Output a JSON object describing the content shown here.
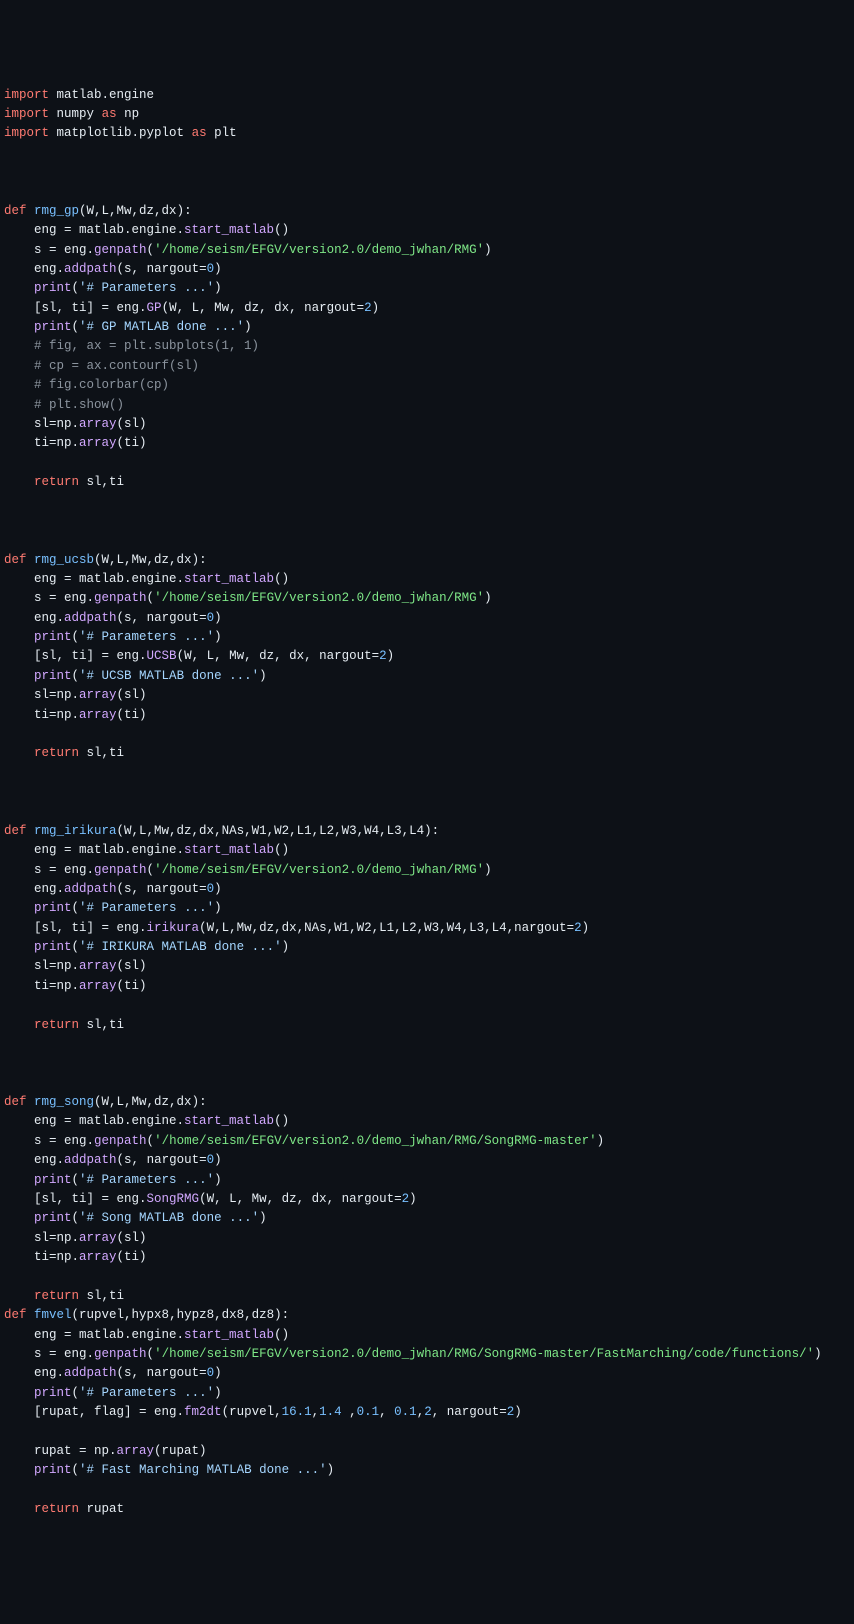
{
  "code": {
    "import1": {
      "kw": "import",
      "mod": "matlab.engine"
    },
    "import2": {
      "kw": "import",
      "mod": "numpy",
      "as": "as",
      "alias": "np"
    },
    "import3": {
      "kw": "import",
      "mod": "matplotlib.pyplot",
      "as": "as",
      "alias": "plt"
    },
    "fn_rmg_gp": {
      "def": "def",
      "name": "rmg_gp",
      "params": "(W,L,Mw,dz,dx):",
      "l1a": "eng = matlab.engine.",
      "l1b": "start_matlab",
      "l1c": "()",
      "l2a": "s = eng.",
      "l2b": "genpath",
      "l2c": "(",
      "l2str": "'/home/seism/EFGV/version2.0/demo_jwhan/RMG'",
      "l2d": ")",
      "l3a": "eng.",
      "l3b": "addpath",
      "l3c": "(s, ",
      "l3d": "nargout",
      "l3e": "=",
      "l3num": "0",
      "l3f": ")",
      "l4a": "print",
      "l4b": "(",
      "l4str": "'# Parameters ...'",
      "l4c": ")",
      "l5a": "[sl, ti] = eng.",
      "l5b": "GP",
      "l5c": "(W, L, Mw, dz, dx, ",
      "l5d": "nargout",
      "l5e": "=",
      "l5num": "2",
      "l5f": ")",
      "l6a": "print",
      "l6b": "(",
      "l6str": "'# GP MATLAB done ...'",
      "l6c": ")",
      "c1": "# fig, ax = plt.subplots(1, 1)",
      "c2": "# cp = ax.contourf(sl)",
      "c3": "# fig.colorbar(cp)",
      "c4": "# plt.show()",
      "l7": "sl=np.",
      "l7b": "array",
      "l7c": "(sl)",
      "l8": "ti=np.",
      "l8b": "array",
      "l8c": "(ti)",
      "ret": "return",
      "retv": " sl,ti"
    },
    "fn_rmg_ucsb": {
      "def": "def",
      "name": "rmg_ucsb",
      "params": "(W,L,Mw,dz,dx):",
      "l1a": "eng = matlab.engine.",
      "l1b": "start_matlab",
      "l1c": "()",
      "l2a": "s = eng.",
      "l2b": "genpath",
      "l2c": "(",
      "l2str": "'/home/seism/EFGV/version2.0/demo_jwhan/RMG'",
      "l2d": ")",
      "l3a": "eng.",
      "l3b": "addpath",
      "l3c": "(s, ",
      "l3d": "nargout",
      "l3e": "=",
      "l3num": "0",
      "l3f": ")",
      "l4a": "print",
      "l4b": "(",
      "l4str": "'# Parameters ...'",
      "l4c": ")",
      "l5a": "[sl, ti] = eng.",
      "l5b": "UCSB",
      "l5c": "(W, L, Mw, dz, dx, ",
      "l5d": "nargout",
      "l5e": "=",
      "l5num": "2",
      "l5f": ")",
      "l6a": "print",
      "l6b": "(",
      "l6str": "'# UCSB MATLAB done ...'",
      "l6c": ")",
      "l7": "sl=np.",
      "l7b": "array",
      "l7c": "(sl)",
      "l8": "ti=np.",
      "l8b": "array",
      "l8c": "(ti)",
      "ret": "return",
      "retv": " sl,ti"
    },
    "fn_rmg_irikura": {
      "def": "def",
      "name": "rmg_irikura",
      "params": "(W,L,Mw,dz,dx,NAs,W1,W2,L1,L2,W3,W4,L3,L4):",
      "l1a": "eng = matlab.engine.",
      "l1b": "start_matlab",
      "l1c": "()",
      "l2a": "s = eng.",
      "l2b": "genpath",
      "l2c": "(",
      "l2str": "'/home/seism/EFGV/version2.0/demo_jwhan/RMG'",
      "l2d": ")",
      "l3a": "eng.",
      "l3b": "addpath",
      "l3c": "(s, ",
      "l3d": "nargout",
      "l3e": "=",
      "l3num": "0",
      "l3f": ")",
      "l4a": "print",
      "l4b": "(",
      "l4str": "'# Parameters ...'",
      "l4c": ")",
      "l5a": "[sl, ti] = eng.",
      "l5b": "irikura",
      "l5c": "(W,L,Mw,dz,dx,NAs,W1,W2,L1,L2,W3,W4,L3,L4,",
      "l5d": "nargout",
      "l5e": "=",
      "l5num": "2",
      "l5f": ")",
      "l6a": "print",
      "l6b": "(",
      "l6str": "'# IRIKURA MATLAB done ...'",
      "l6c": ")",
      "l7": "sl=np.",
      "l7b": "array",
      "l7c": "(sl)",
      "l8": "ti=np.",
      "l8b": "array",
      "l8c": "(ti)",
      "ret": "return",
      "retv": " sl,ti"
    },
    "fn_rmg_song": {
      "def": "def",
      "name": "rmg_song",
      "params": "(W,L,Mw,dz,dx):",
      "l1a": "eng = matlab.engine.",
      "l1b": "start_matlab",
      "l1c": "()",
      "l2a": "s = eng.",
      "l2b": "genpath",
      "l2c": "(",
      "l2str": "'/home/seism/EFGV/version2.0/demo_jwhan/RMG/SongRMG-master'",
      "l2d": ")",
      "l3a": "eng.",
      "l3b": "addpath",
      "l3c": "(s, ",
      "l3d": "nargout",
      "l3e": "=",
      "l3num": "0",
      "l3f": ")",
      "l4a": "print",
      "l4b": "(",
      "l4str": "'# Parameters ...'",
      "l4c": ")",
      "l5a": "[sl, ti] = eng.",
      "l5b": "SongRMG",
      "l5c": "(W, L, Mw, dz, dx, ",
      "l5d": "nargout",
      "l5e": "=",
      "l5num": "2",
      "l5f": ")",
      "l6a": "print",
      "l6b": "(",
      "l6str": "'# Song MATLAB done ...'",
      "l6c": ")",
      "l7": "sl=np.",
      "l7b": "array",
      "l7c": "(sl)",
      "l8": "ti=np.",
      "l8b": "array",
      "l8c": "(ti)",
      "ret": "return",
      "retv": " sl,ti"
    },
    "fn_fmvel": {
      "def": "def",
      "name": "fmvel",
      "params": "(rupvel,hypx8,hypz8,dx8,dz8):",
      "l1a": "eng = matlab.engine.",
      "l1b": "start_matlab",
      "l1c": "()",
      "l2a": "s = eng.",
      "l2b": "genpath",
      "l2c": "(",
      "l2str": "'/home/seism/EFGV/version2.0/demo_jwhan/RMG/SongRMG-master/FastMarching/code/functions/'",
      "l2d": ")",
      "l3a": "eng.",
      "l3b": "addpath",
      "l3c": "(s, ",
      "l3d": "nargout",
      "l3e": "=",
      "l3num": "0",
      "l3f": ")",
      "l4a": "print",
      "l4b": "(",
      "l4str": "'# Parameters ...'",
      "l4c": ")",
      "l5a": "[rupat, flag] = eng.",
      "l5b": "fm2dt",
      "l5c": "(rupvel,",
      "l5n1": "16.1",
      "l5s1": ",",
      "l5n2": "1.4",
      "l5s2": " ,",
      "l5n3": "0.1",
      "l5s3": ", ",
      "l5n4": "0.1",
      "l5s4": ",",
      "l5n5": "2",
      "l5s5": ", ",
      "l5d": "nargout",
      "l5e": "=",
      "l5num": "2",
      "l5f": ")",
      "l7": "rupat = np.",
      "l7b": "array",
      "l7c": "(rupat)",
      "l6a": "print",
      "l6b": "(",
      "l6str": "'# Fast Marching MATLAB done ...'",
      "l6c": ")",
      "ret": "return",
      "retv": " rupat"
    }
  }
}
